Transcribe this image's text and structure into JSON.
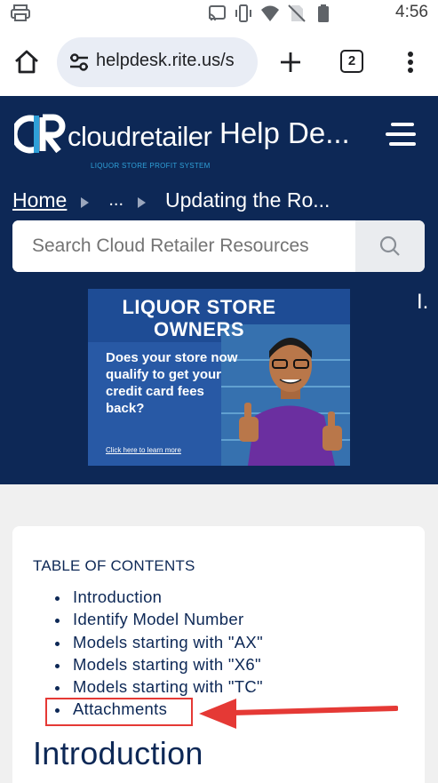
{
  "status_bar": {
    "time": "4:56",
    "icons": [
      "printer-icon",
      "cast-icon",
      "vibrate-icon",
      "wifi-icon",
      "no-sim-icon",
      "battery-icon"
    ]
  },
  "browser": {
    "url": "helpdesk.rite.us/s",
    "tab_count": "2",
    "icons": [
      "home-icon",
      "site-settings-icon",
      "new-tab-icon",
      "tabs-icon",
      "more-vert-icon"
    ]
  },
  "site": {
    "brand": "cloudretailer",
    "logo_letters": "CR",
    "tagline": "LIQUOR STORE PROFIT SYSTEM",
    "title": "Help De...",
    "colors": {
      "header": "#0d2856",
      "accent": "#2fa0d8",
      "annotation": "#e53935"
    }
  },
  "breadcrumb": {
    "home": "Home",
    "ellipsis": "...",
    "current": "Updating the Ro..."
  },
  "search": {
    "placeholder": "Search Cloud Retailer Resources"
  },
  "side_mark": "I.",
  "ad": {
    "headline_1": "LIQUOR STORE",
    "headline_2": "OWNERS",
    "body": "Does your store now qualify to get your credit card fees back?",
    "cta": "Click here to learn more"
  },
  "toc": {
    "title": "TABLE OF CONTENTS",
    "items": [
      "Introduction",
      "Identify Model Number",
      "Models starting with \"AX\"",
      "Models starting with \"X6\"",
      "Models starting with \"TC\"",
      "Attachments"
    ]
  },
  "section": {
    "heading": "Introduction"
  }
}
